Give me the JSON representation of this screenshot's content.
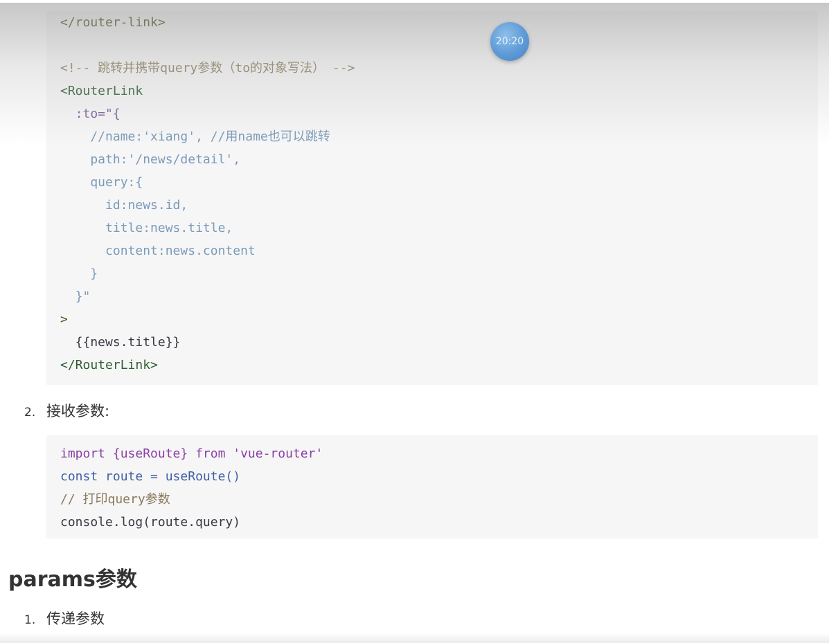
{
  "overlay": {
    "clock": "20:20"
  },
  "code_block_1": {
    "lines": [
      "</router-link>",
      "",
      "<!-- 跳转并携带query参数（to的对象写法） -->",
      "<RouterLink",
      "  :to=\"{",
      "    //name:'xiang', //用name也可以跳转",
      "    path:'/news/detail',",
      "    query:{",
      "      id:news.id,",
      "      title:news.title,",
      "      content:news.content",
      "    }",
      "  }\"",
      ">",
      "  {{news.title}}",
      "</RouterLink>"
    ]
  },
  "list_item_2": {
    "number": "2.",
    "text": "接收参数:"
  },
  "code_block_2": {
    "lines": [
      "import {useRoute} from 'vue-router'",
      "const route = useRoute()",
      "// 打印query参数",
      "console.log(route.query)"
    ]
  },
  "heading": {
    "text": "params参数"
  },
  "list_item_1": {
    "number": "1.",
    "text": "传递参数"
  }
}
